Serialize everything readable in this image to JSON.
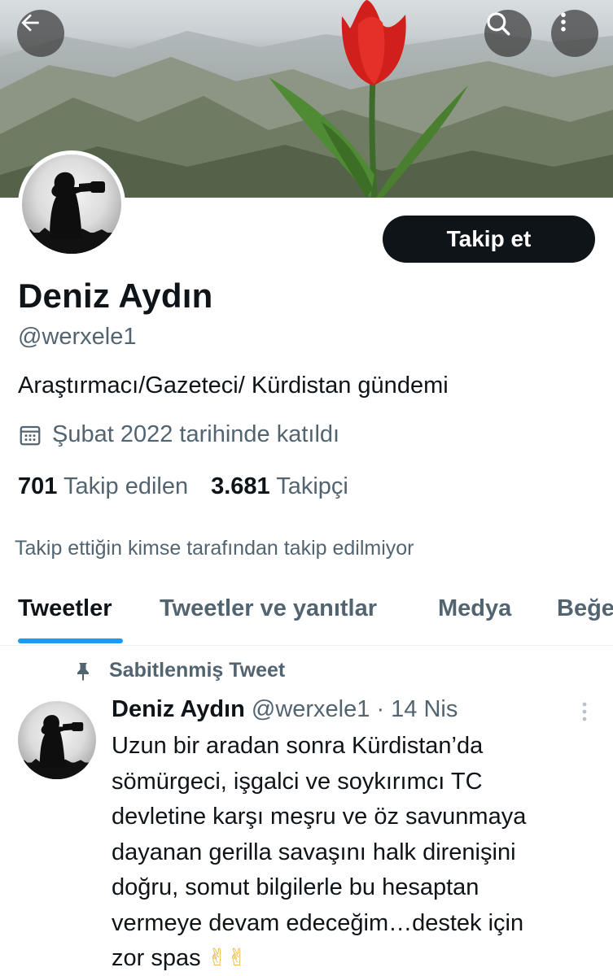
{
  "header": {
    "back_icon": "arrow-left-icon",
    "search_icon": "search-icon",
    "more_icon": "more-vertical-icon"
  },
  "profile": {
    "follow_label": "Takip et",
    "name": "Deniz Aydın",
    "handle": "@werxele1",
    "bio": "Araştırmacı/Gazeteci/ Kürdistan gündemi",
    "joined": "Şubat 2022 tarihinde katıldı",
    "following_count": "701",
    "following_label": "Takip edilen",
    "followers_count": "3.681",
    "followers_label": "Takipçi",
    "no_mutual": "Takip ettiğin kimse tarafından takip edilmiyor"
  },
  "tabs": [
    {
      "label": "Tweetler",
      "active": true
    },
    {
      "label": "Tweetler ve yanıtlar",
      "active": false
    },
    {
      "label": "Medya",
      "active": false
    },
    {
      "label": "Beğe",
      "active": false
    }
  ],
  "tweet": {
    "pinned_label": "Sabitlenmiş Tweet",
    "author_name": "Deniz Aydın",
    "author_handle": "@werxele1",
    "separator": "·",
    "date": "14 Nis",
    "lines": [
      "Uzun bir aradan sonra Kürdistan’da",
      "sömürgeci, işgalci ve soykırımcı TC",
      "devletine karşı meşru ve öz savunmaya",
      "dayanan gerilla savaşını halk direnişini",
      "doğru, somut bilgilerle bu hesaptan",
      "vermeye devam edeceğim…destek için",
      "zor spas"
    ],
    "emoji": "✌✌"
  },
  "colors": {
    "accent": "#1d9bf0",
    "text": "#0f1419",
    "secondary": "#536471"
  }
}
